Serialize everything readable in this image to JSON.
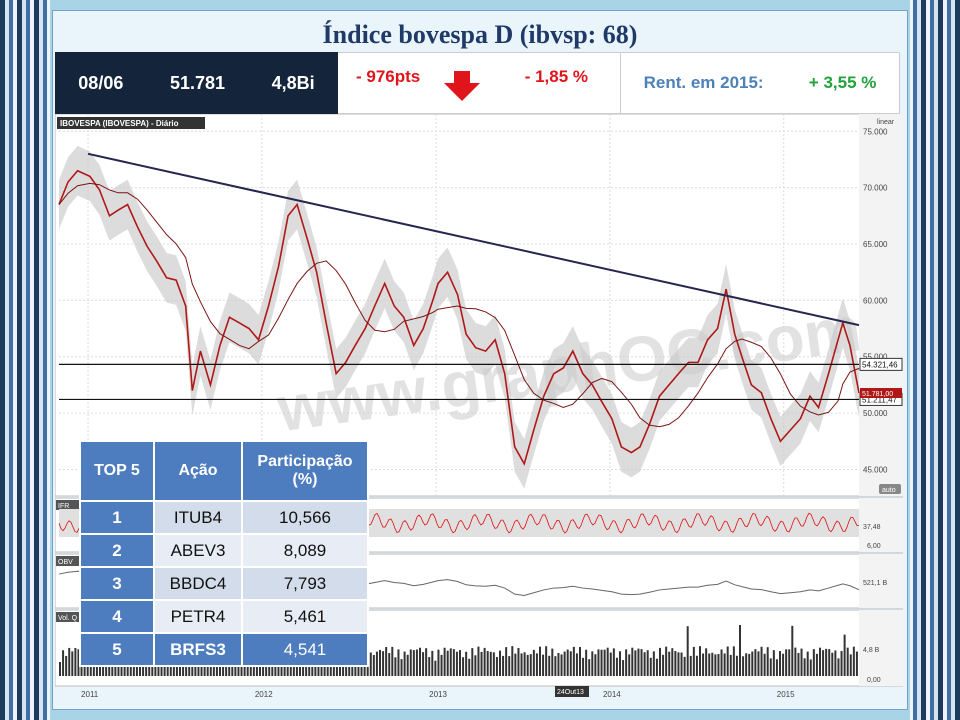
{
  "title": "Índice bovespa D (ibvsp: 68)",
  "info": {
    "date": "08/06",
    "close": "51.781",
    "volume": "4,8Bi",
    "change_pts": "- 976pts",
    "change_pct": "- 1,85 %",
    "rent_label": "Rent. em 2015:",
    "rent_value": "+ 3,55 %"
  },
  "colors": {
    "negative": "#e0141b",
    "positive": "#1fa33a",
    "header_dark": "#13243b",
    "table_accent": "#4e7dbf"
  },
  "chart_data": {
    "type": "line",
    "panel_label": "IBOVESPA (IBOVESPA) - Diário",
    "scale_label": "linear",
    "auto_label": "auto",
    "ylim": [
      43000,
      76000
    ],
    "y_ticks": [
      45000,
      50000,
      55000,
      60000,
      65000,
      70000,
      75000
    ],
    "y_tick_labels": [
      "45.000",
      "50.000",
      "55.000",
      "60.000",
      "65.000",
      "70.000",
      "75.000"
    ],
    "x_range": [
      "2010-11-01",
      "2015-06-08"
    ],
    "x_ticks": [
      "2011-01-01",
      "2012-01-01",
      "2013-01-01",
      "2014-01-01",
      "2015-01-01"
    ],
    "x_tick_labels": [
      "2011",
      "2012",
      "2013",
      "2014",
      "2015"
    ],
    "cursor_date_label": "24Out13",
    "watermark": "www.graphOC.com",
    "price_series": {
      "name": "IBOVESPA",
      "x": [
        "2010-11-01",
        "2010-11-20",
        "2010-12-10",
        "2011-01-05",
        "2011-01-25",
        "2011-02-15",
        "2011-03-05",
        "2011-03-25",
        "2011-04-15",
        "2011-05-05",
        "2011-05-25",
        "2011-06-15",
        "2011-07-05",
        "2011-07-25",
        "2011-08-08",
        "2011-08-25",
        "2011-09-15",
        "2011-10-05",
        "2011-10-25",
        "2011-11-15",
        "2011-12-05",
        "2011-12-25",
        "2012-01-15",
        "2012-02-05",
        "2012-02-25",
        "2012-03-15",
        "2012-04-05",
        "2012-04-25",
        "2012-05-15",
        "2012-06-05",
        "2012-06-25",
        "2012-07-15",
        "2012-08-05",
        "2012-08-25",
        "2012-09-15",
        "2012-10-05",
        "2012-10-25",
        "2012-11-15",
        "2012-12-05",
        "2012-12-25",
        "2013-01-05",
        "2013-01-25",
        "2013-02-15",
        "2013-03-05",
        "2013-03-25",
        "2013-04-15",
        "2013-05-05",
        "2013-05-25",
        "2013-06-15",
        "2013-07-05",
        "2013-07-25",
        "2013-08-15",
        "2013-09-05",
        "2013-09-25",
        "2013-10-15",
        "2013-11-05",
        "2013-11-25",
        "2013-12-15",
        "2014-01-05",
        "2014-01-25",
        "2014-02-15",
        "2014-03-05",
        "2014-03-25",
        "2014-04-15",
        "2014-05-05",
        "2014-05-25",
        "2014-06-15",
        "2014-07-05",
        "2014-07-25",
        "2014-08-15",
        "2014-09-02",
        "2014-09-20",
        "2014-10-05",
        "2014-10-25",
        "2014-11-15",
        "2014-12-05",
        "2014-12-25",
        "2015-01-15",
        "2015-02-05",
        "2015-02-25",
        "2015-03-15",
        "2015-04-05",
        "2015-04-25",
        "2015-05-05",
        "2015-05-20",
        "2015-06-08"
      ],
      "values": [
        68500,
        70500,
        71500,
        71000,
        69800,
        67500,
        68000,
        68500,
        66500,
        64800,
        63500,
        62000,
        61800,
        59500,
        52000,
        55500,
        52500,
        56000,
        58500,
        58000,
        57500,
        56500,
        59500,
        63000,
        67500,
        68500,
        65500,
        62500,
        58000,
        53500,
        54500,
        56000,
        57500,
        59500,
        61500,
        59500,
        58500,
        56000,
        57500,
        60000,
        61500,
        62500,
        60500,
        57000,
        55800,
        55500,
        56500,
        53500,
        47000,
        45500,
        48500,
        51500,
        53500,
        54000,
        55500,
        53500,
        52500,
        51000,
        49500,
        47000,
        46500,
        47000,
        49000,
        51500,
        52500,
        53500,
        54500,
        54500,
        56500,
        57500,
        61000,
        57000,
        55000,
        52500,
        51800,
        49500,
        47500,
        48500,
        49500,
        51500,
        50500,
        53500,
        56500,
        58000,
        56000,
        51781
      ]
    },
    "resistance_line": {
      "x": [
        "2011-01-01",
        "2015-06-08"
      ],
      "values": [
        73000,
        57800
      ]
    },
    "horizontal_levels": [
      {
        "value": 54321.46,
        "label": "54.321,46"
      },
      {
        "value": 51211.47,
        "label": "51.211,47"
      }
    ],
    "last_price_label": "51.781,00",
    "indicators": [
      {
        "name": "IFR",
        "value_label": "37,48",
        "min_label": "6,00"
      },
      {
        "name": "OBV",
        "value_label": "521,1 B"
      },
      {
        "name": "Vol. Q",
        "value_label": "4,8 B",
        "min_label": "0,00"
      }
    ]
  },
  "table": {
    "headers": [
      "TOP 5",
      "Ação",
      "Participação (%)"
    ],
    "rows": [
      {
        "rank": "1",
        "ticker": "ITUB4",
        "weight": "10,566"
      },
      {
        "rank": "2",
        "ticker": "ABEV3",
        "weight": "8,089"
      },
      {
        "rank": "3",
        "ticker": "BBDC4",
        "weight": "7,793"
      },
      {
        "rank": "4",
        "ticker": "PETR4",
        "weight": "5,461"
      },
      {
        "rank": "5",
        "ticker": "BRFS3",
        "weight": "4,541"
      }
    ]
  }
}
